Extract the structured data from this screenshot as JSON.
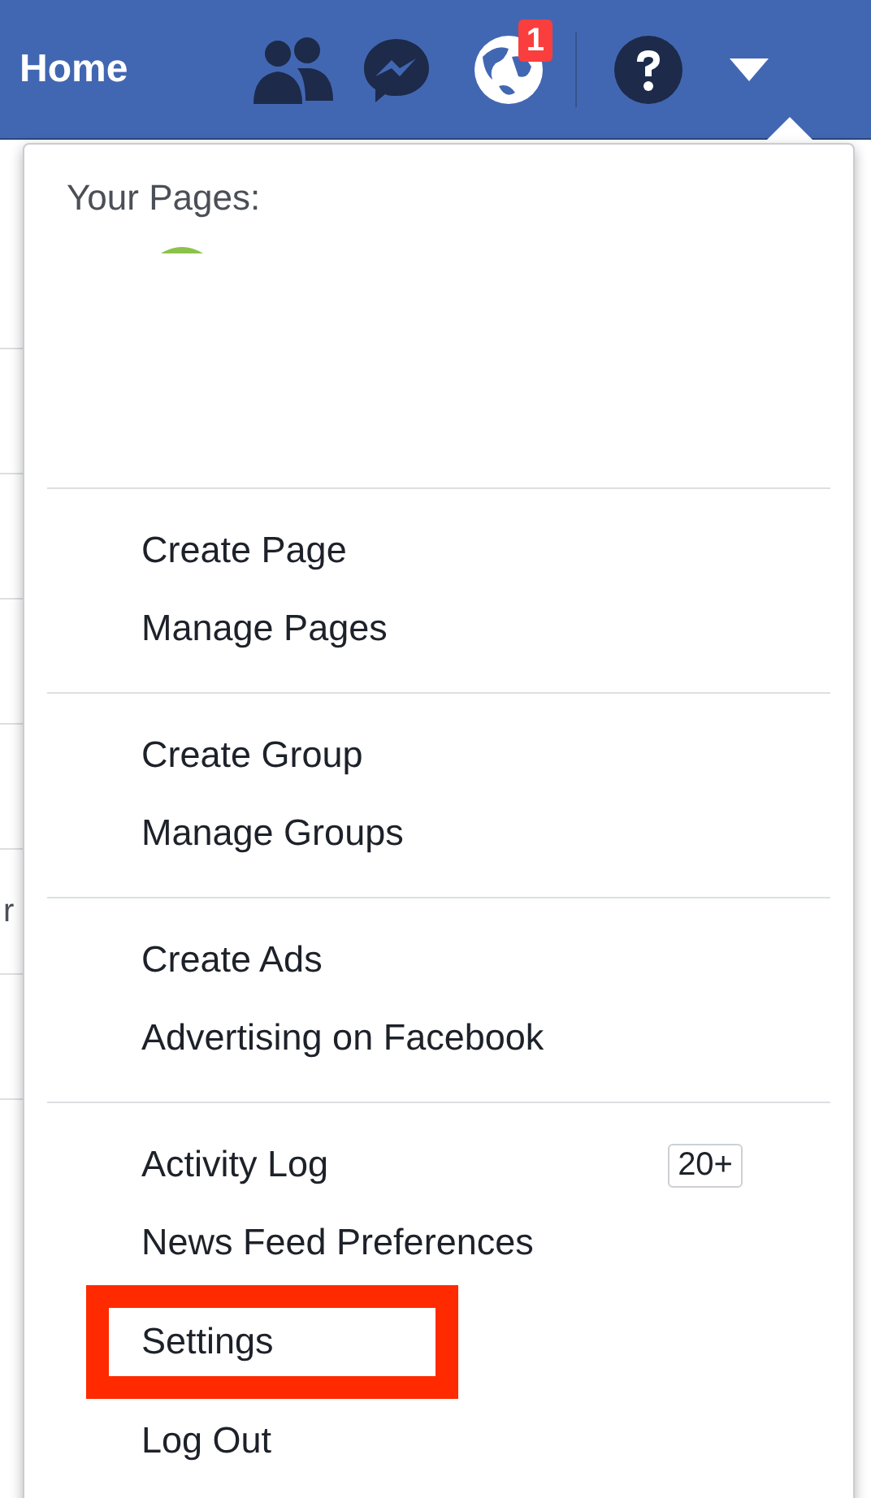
{
  "nav": {
    "title": "Home",
    "notification_badge": "1"
  },
  "background": {
    "fragment": "r"
  },
  "menu": {
    "header": "Your Pages:",
    "sections": [
      {
        "items": [
          {
            "label": "Create Page",
            "highlighted": false
          },
          {
            "label": "Manage Pages",
            "highlighted": false
          }
        ]
      },
      {
        "items": [
          {
            "label": "Create Group",
            "highlighted": false
          },
          {
            "label": "Manage Groups",
            "highlighted": false
          }
        ]
      },
      {
        "items": [
          {
            "label": "Create Ads",
            "highlighted": false
          },
          {
            "label": "Advertising on Facebook",
            "highlighted": false
          }
        ]
      },
      {
        "items": [
          {
            "label": "Activity Log",
            "badge": "20+",
            "highlighted": false
          },
          {
            "label": "News Feed Preferences",
            "highlighted": false
          },
          {
            "label": "Settings",
            "highlighted": true
          },
          {
            "label": "Log Out",
            "highlighted": false
          }
        ]
      }
    ]
  }
}
